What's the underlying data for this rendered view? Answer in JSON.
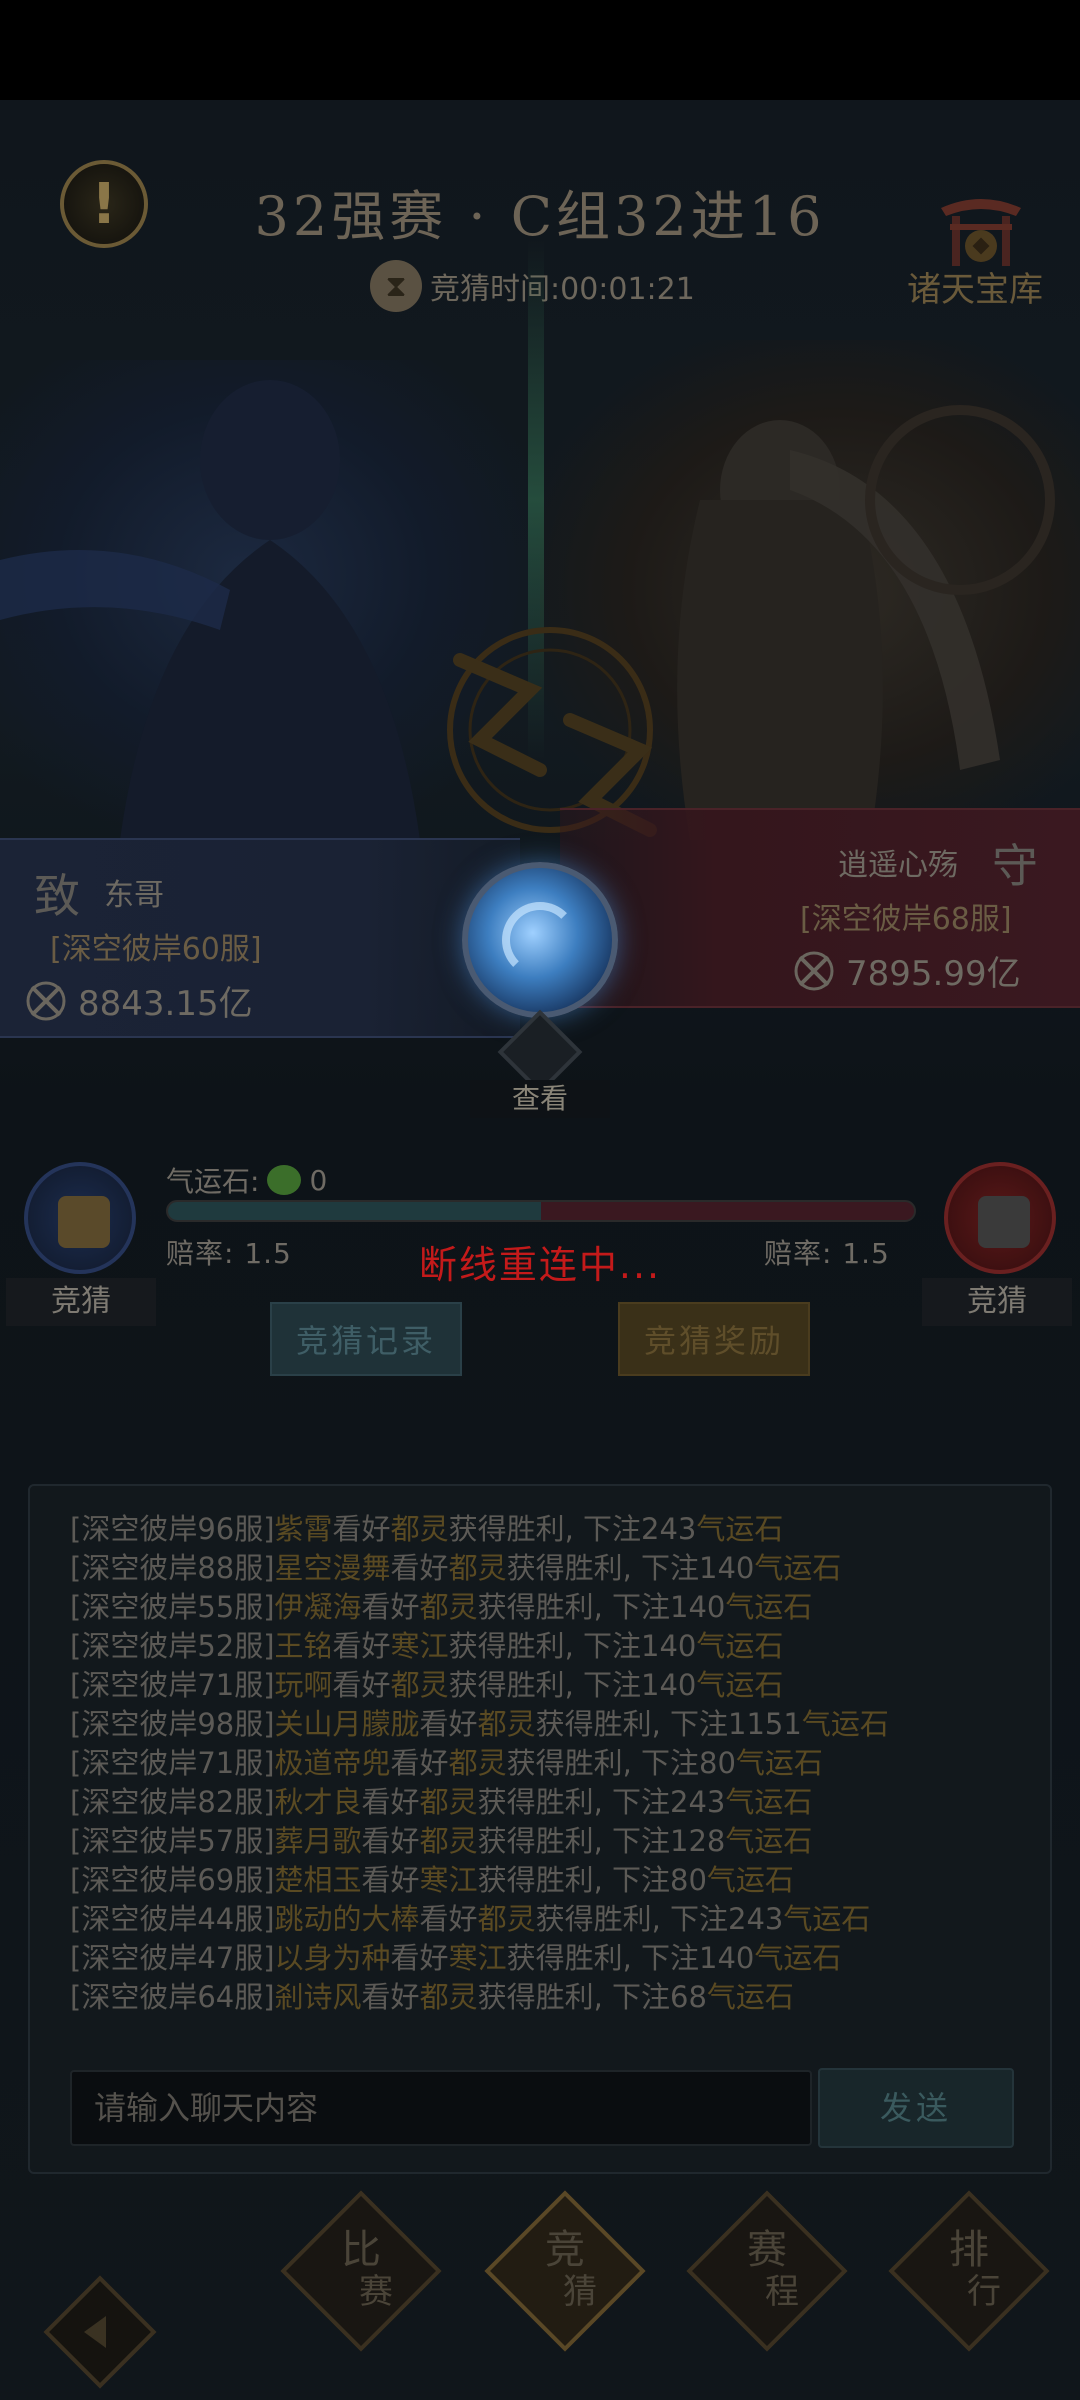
{
  "header": {
    "title": "32强赛 · C组32进16",
    "timer_text": "竞猜时间:00:01:21",
    "info_icon": "!",
    "treasury_label": "诸天宝库"
  },
  "players": {
    "left": {
      "emblem": "致",
      "name": "东哥",
      "server": "[深空彼岸60服]",
      "power": "8843.15亿"
    },
    "right": {
      "emblem": "守",
      "name": "逍遥心殇",
      "server": "[深空彼岸68服]",
      "power": "7895.99亿"
    }
  },
  "center": {
    "view_label": "查看"
  },
  "betting": {
    "stone_label": "气运石:",
    "stone_count": "0",
    "left_share": 0.5,
    "odds_left": "赔率: 1.5",
    "odds_right": "赔率: 1.5",
    "guess_left": "竞猜",
    "guess_right": "竞猜",
    "reconnect": "断线重连中...",
    "record_button": "竞猜记录",
    "reward_button": "竞猜奖励"
  },
  "chat": {
    "lines": [
      {
        "server": "[深空彼岸96服]",
        "player": "紫霄",
        "mid": "看好",
        "team": "都灵",
        "mid2": "获得胜利, 下注",
        "amount": "243",
        "unit": "气运石"
      },
      {
        "server": "[深空彼岸88服]",
        "player": "星空漫舞",
        "mid": "看好",
        "team": "都灵",
        "mid2": "获得胜利, 下注",
        "amount": "140",
        "unit": "气运石"
      },
      {
        "server": "[深空彼岸55服]",
        "player": "伊凝海",
        "mid": "看好",
        "team": "都灵",
        "mid2": "获得胜利, 下注",
        "amount": "140",
        "unit": "气运石"
      },
      {
        "server": "[深空彼岸52服]",
        "player": "王铭",
        "mid": "看好",
        "team": "寒江",
        "mid2": "获得胜利, 下注",
        "amount": "140",
        "unit": "气运石"
      },
      {
        "server": "[深空彼岸71服]",
        "player": "玩啊",
        "mid": "看好",
        "team": "都灵",
        "mid2": "获得胜利, 下注",
        "amount": "140",
        "unit": "气运石"
      },
      {
        "server": "[深空彼岸98服]",
        "player": "关山月朦胧",
        "mid": "看好",
        "team": "都灵",
        "mid2": "获得胜利, 下注",
        "amount": "1151",
        "unit": "气运石"
      },
      {
        "server": "[深空彼岸71服]",
        "player": "极道帝兜",
        "mid": "看好",
        "team": "都灵",
        "mid2": "获得胜利, 下注",
        "amount": "80",
        "unit": "气运石"
      },
      {
        "server": "[深空彼岸82服]",
        "player": "秋才良",
        "mid": "看好",
        "team": "都灵",
        "mid2": "获得胜利, 下注",
        "amount": "243",
        "unit": "气运石"
      },
      {
        "server": "[深空彼岸57服]",
        "player": "葬月歌",
        "mid": "看好",
        "team": "都灵",
        "mid2": "获得胜利, 下注",
        "amount": "128",
        "unit": "气运石"
      },
      {
        "server": "[深空彼岸69服]",
        "player": "楚相玉",
        "mid": "看好",
        "team": "寒江",
        "mid2": "获得胜利, 下注",
        "amount": "80",
        "unit": "气运石"
      },
      {
        "server": "[深空彼岸44服]",
        "player": "跳动的大棒",
        "mid": "看好",
        "team": "都灵",
        "mid2": "获得胜利, 下注",
        "amount": "243",
        "unit": "气运石"
      },
      {
        "server": "[深空彼岸47服]",
        "player": "以身为种",
        "mid": "看好",
        "team": "寒江",
        "mid2": "获得胜利, 下注",
        "amount": "140",
        "unit": "气运石"
      },
      {
        "server": "[深空彼岸64服]",
        "player": "剎诗风",
        "mid": "看好",
        "team": "都灵",
        "mid2": "获得胜利, 下注",
        "amount": "68",
        "unit": "气运石"
      }
    ],
    "input_placeholder": "请输入聊天内容",
    "send_label": "发送"
  },
  "nav": [
    {
      "top": "比",
      "bottom": "赛"
    },
    {
      "top": "竞",
      "bottom": "猜"
    },
    {
      "top": "赛",
      "bottom": "程"
    },
    {
      "top": "排",
      "bottom": "行"
    }
  ],
  "colors": {
    "reconnect": "#c41a1a",
    "highlight": "#5a4a22",
    "left_team": "#1b2336",
    "right_team": "#3a1820"
  }
}
